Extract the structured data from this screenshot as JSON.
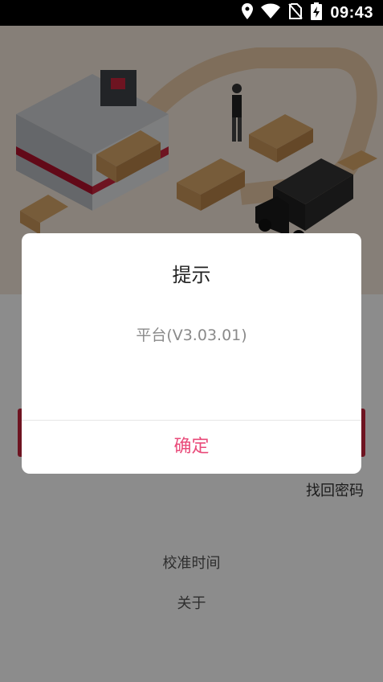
{
  "status_bar": {
    "time": "09:43",
    "icons": [
      "location-icon",
      "wifi-icon",
      "no-sim-icon",
      "battery-charging-icon"
    ]
  },
  "login": {
    "find_password": "找回密码",
    "calibrate_time": "校准时间",
    "about": "关于"
  },
  "dialog": {
    "title": "提示",
    "message": "平台(V3.03.01)",
    "confirm_label": "确定"
  },
  "colors": {
    "accent_pink": "#e94b7a",
    "brand_red": "#c9263d",
    "illustration_bg": "#f4e7da"
  }
}
